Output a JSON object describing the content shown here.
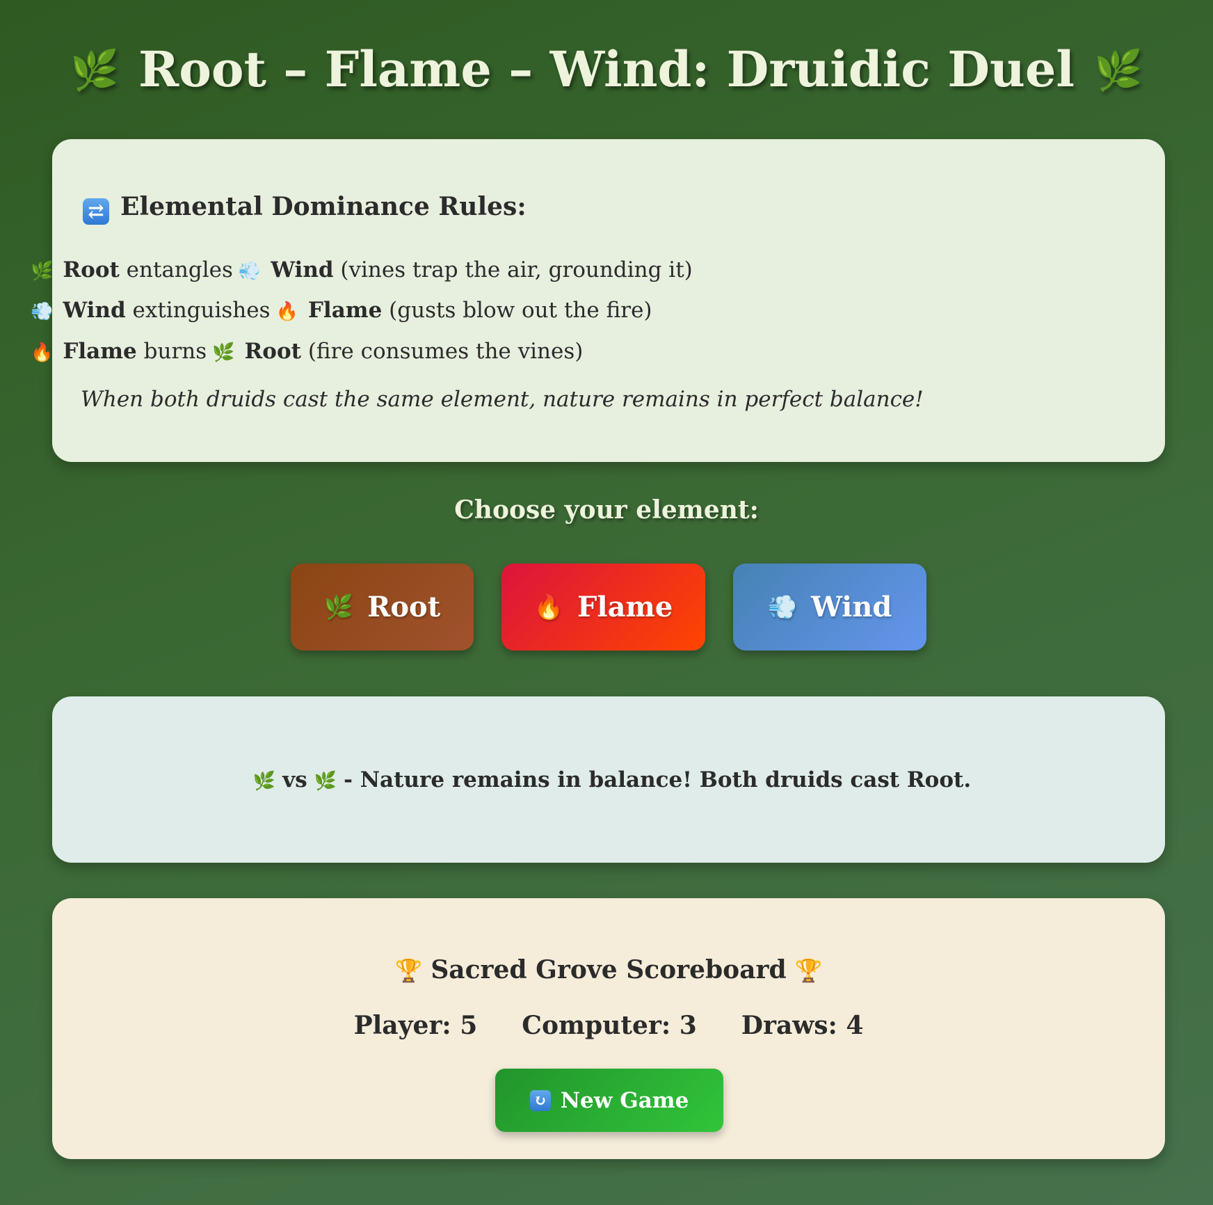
{
  "header": {
    "title": "Root – Flame – Wind: Druidic Duel",
    "leaf_glyph": "🌿"
  },
  "rules": {
    "heading_icon": "⇄",
    "heading": "Elemental Dominance Rules:",
    "items": [
      {
        "icon1": "🌿",
        "a": "Root",
        "verb": "entangles",
        "icon2": "💨",
        "b": "Wind",
        "reason": "(vines trap the air, grounding it)"
      },
      {
        "icon1": "💨",
        "a": "Wind",
        "verb": "extinguishes",
        "icon2": "🔥",
        "b": "Flame",
        "reason": "(gusts blow out the fire)"
      },
      {
        "icon1": "🔥",
        "a": "Flame",
        "verb": "burns",
        "icon2": "🌿",
        "b": "Root",
        "reason": "(fire consumes the vines)"
      }
    ],
    "note": "When both druids cast the same element, nature remains in perfect balance!"
  },
  "choose_label": "Choose your element:",
  "choices": [
    {
      "icon": "🌿",
      "label": "Root"
    },
    {
      "icon": "🔥",
      "label": "Flame"
    },
    {
      "icon": "💨",
      "label": "Wind"
    }
  ],
  "result": {
    "player_icon": "🌿",
    "vs": "vs",
    "computer_icon": "🌿",
    "message": "- Nature remains in balance! Both druids cast Root."
  },
  "scoreboard": {
    "trophy": "🏆",
    "title": "Sacred Grove Scoreboard",
    "player": "Player: 5",
    "computer": "Computer: 3",
    "draws": "Draws: 4",
    "new_game_icon": "↻",
    "new_game_label": "New Game"
  },
  "colors": {
    "root": "#8b4513",
    "flame": "#dc143c",
    "wind": "#4682b4",
    "new_game": "#22942c"
  }
}
